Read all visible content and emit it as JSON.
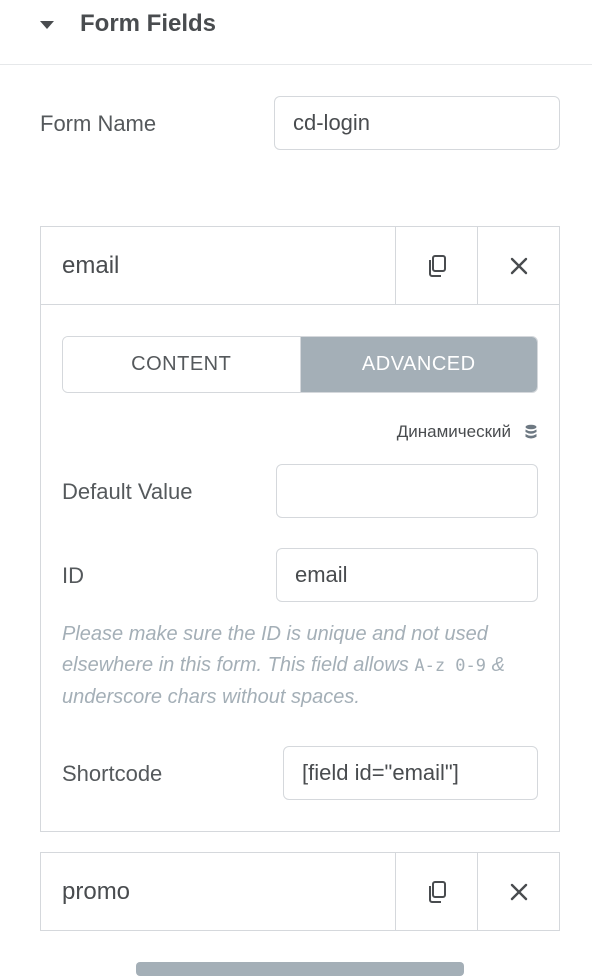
{
  "section": {
    "title": "Form Fields"
  },
  "form_name": {
    "label": "Form Name",
    "value": "cd-login"
  },
  "fields": [
    {
      "title": "email",
      "tabs": {
        "content": "CONTENT",
        "advanced": "ADVANCED",
        "active": "advanced"
      },
      "dynamic_label": "Динамический",
      "default_value": {
        "label": "Default Value",
        "value": ""
      },
      "id": {
        "label": "ID",
        "value": "email"
      },
      "help": {
        "text_before": "Please make sure the ID is unique and not used elsewhere in this form. This field allows ",
        "code_chars": "A-z 0-9",
        "text_after": " & underscore chars without spaces."
      },
      "shortcode": {
        "label": "Shortcode",
        "value": "[field id=\"email\"]"
      }
    },
    {
      "title": "promo"
    }
  ],
  "icons": {
    "duplicate": "duplicate-icon",
    "remove": "close-icon",
    "dynamic": "database-icon",
    "collapse": "caret-down-icon"
  },
  "colors": {
    "tab_active_bg": "#a4afb7",
    "border": "#d5d8dc",
    "help_text": "#a4afb7"
  }
}
